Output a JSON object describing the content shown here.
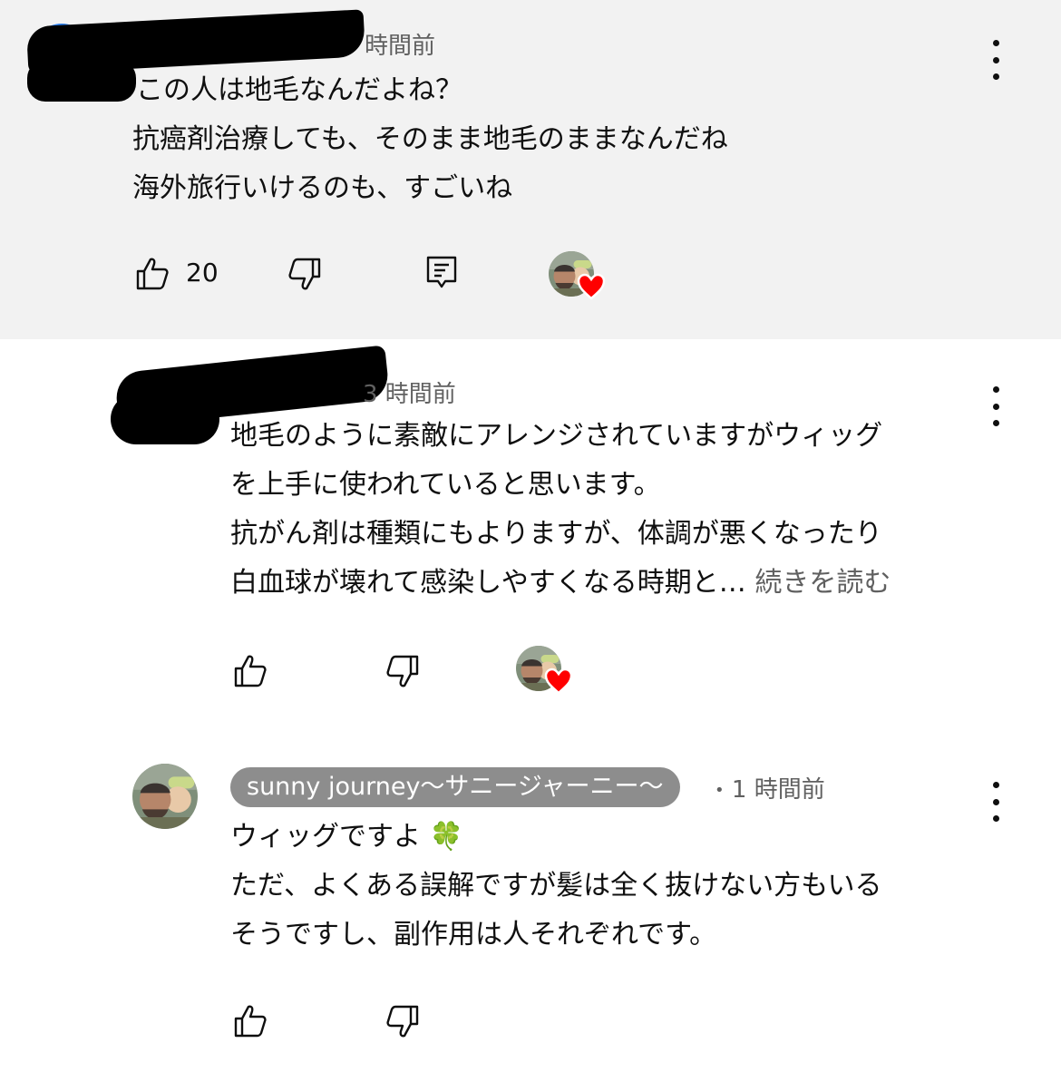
{
  "comments": [
    {
      "timestamp": "時間前",
      "lines": [
        "この人は地毛なんだよね？",
        "抗癌剤治療しても、そのまま地毛のままなんだね",
        "海外旅行いけるのも、すごいね"
      ],
      "like_count": "20",
      "avatar_color": "#2b7de9",
      "creator_hearted": true
    },
    {
      "timestamp": "3 時間前",
      "lines": [
        "地毛のように素敵にアレンジされていますがウィッグ",
        "を上手に使われていると思います。",
        "抗がん剤は種類にもよりますが、体調が悪くなったり"
      ],
      "last_line": "白血球が壊れて感染しやすくなる時期と…",
      "read_more": "続きを読む",
      "avatar_color": "#f07a1e",
      "creator_hearted": true
    },
    {
      "author": "sunny journey〜サニージャーニー〜",
      "separator": "•",
      "timestamp": "1 時間前",
      "line1": "ウィッグですよ",
      "emoji": "🍀",
      "lines": [
        "ただ、よくある誤解ですが髪は全く抜けない方もいる",
        "そうですし、副作用は人それぞれです。"
      ]
    }
  ],
  "icons": {
    "like": "thumbs-up-icon",
    "dislike": "thumbs-down-icon",
    "reply": "reply-icon",
    "menu": "kebab-menu-icon",
    "heart": "heart-icon"
  },
  "colors": {
    "highlight_bg": "#f2f2f2",
    "heart": "#ff0000",
    "chip_bg": "#8d8d8d",
    "meta_text": "#606060"
  }
}
